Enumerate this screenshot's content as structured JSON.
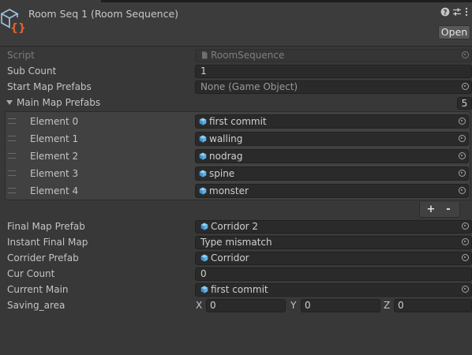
{
  "header": {
    "title": "Room Seq 1 (Room Sequence)",
    "open_button": "Open",
    "icons": [
      "help-icon",
      "settings-sliders-icon",
      "more-menu-icon"
    ]
  },
  "script_row": {
    "label": "Script",
    "value": "RoomSequence"
  },
  "sub_count": {
    "label": "Sub Count",
    "value": "1"
  },
  "start_map_prefabs": {
    "label": "Start Map Prefabs",
    "value": "None (Game Object)"
  },
  "main_map_prefabs": {
    "label": "Main Map Prefabs",
    "size": "5",
    "elements": [
      {
        "label": "Element 0",
        "value": "first commit"
      },
      {
        "label": "Element 1",
        "value": "walling"
      },
      {
        "label": "Element 2",
        "value": "nodrag"
      },
      {
        "label": "Element 3",
        "value": "spine"
      },
      {
        "label": "Element 4",
        "value": "monster"
      }
    ],
    "add_label": "+",
    "remove_label": "-"
  },
  "final_map_prefab": {
    "label": "Final Map Prefab",
    "value": "Corridor 2"
  },
  "instant_final_map": {
    "label": "Instant Final Map",
    "value": "Type mismatch"
  },
  "corrider_prefab": {
    "label": "Corrider Prefab",
    "value": "Corridor"
  },
  "cur_count": {
    "label": "Cur Count",
    "value": "0"
  },
  "current_main": {
    "label": "Current Main",
    "value": "first commit"
  },
  "saving_area": {
    "label": "Saving_area",
    "x_label": "X",
    "x": "0",
    "y_label": "Y",
    "y": "0",
    "z_label": "Z",
    "z": "0"
  },
  "colors": {
    "background": "#383838",
    "field": "#2a2a2a",
    "prefab_icon": "#5fb0e8",
    "script_icon_braces": "#e0612e"
  }
}
